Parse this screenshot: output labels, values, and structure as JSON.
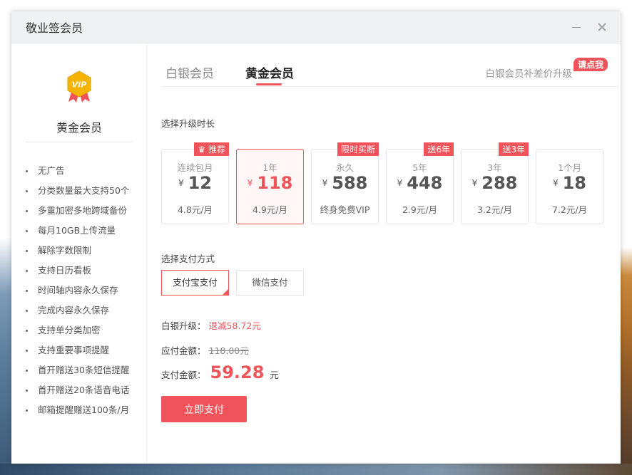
{
  "window": {
    "title": "敬业签会员"
  },
  "sidebar": {
    "badge_text": "VIP",
    "member_name": "黄金会员",
    "benefits": [
      "无广告",
      "分类数量最大支持50个",
      "多重加密多地跨域备份",
      "每月10GB上传流量",
      "解除字数限制",
      "支持日历看板",
      "时间轴内容永久保存",
      "完成内容永久保存",
      "支持单分类加密",
      "支持重要事项提醒",
      "首开赠送30条短信提醒",
      "首开赠送20条语音电话",
      "邮箱提醒赠送100条/月"
    ]
  },
  "tabs": {
    "silver": "白银会员",
    "gold": "黄金会员",
    "upgrade_link": "白银会员补差价升级",
    "upgrade_badge": "请点我"
  },
  "duration": {
    "label": "选择升级时长",
    "plans": [
      {
        "name": "连续包月",
        "currency": "¥",
        "price": "12",
        "unit": "4.8元/月",
        "tag": "推荐"
      },
      {
        "name": "1年",
        "currency": "¥",
        "price": "118",
        "unit": "4.9元/月",
        "tag": ""
      },
      {
        "name": "永久",
        "currency": "¥",
        "price": "588",
        "unit": "终身免费VIP",
        "tag": "限时买断"
      },
      {
        "name": "5年",
        "currency": "¥",
        "price": "448",
        "unit": "2.9元/月",
        "tag": "送6年"
      },
      {
        "name": "3年",
        "currency": "¥",
        "price": "288",
        "unit": "3.2元/月",
        "tag": "送3年"
      },
      {
        "name": "1个月",
        "currency": "¥",
        "price": "18",
        "unit": "7.2元/月",
        "tag": ""
      }
    ],
    "selected_index": 1
  },
  "payment": {
    "label": "选择支付方式",
    "alipay": "支付宝支付",
    "wechat": "微信支付",
    "selected": "支付宝支付"
  },
  "summary": {
    "silver_label": "白银升级：",
    "silver_value": "退减58.72元",
    "due_label": "应付金额：",
    "due_value": "118.00元",
    "pay_label": "支付金额：",
    "pay_value": "59.28",
    "pay_unit": "元"
  },
  "actions": {
    "pay_now": "立即支付"
  },
  "colors": {
    "accent": "#f0545a",
    "gold": "#f5b400"
  }
}
